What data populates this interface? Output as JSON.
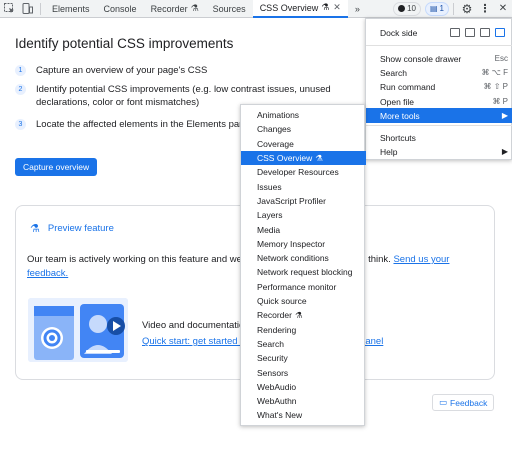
{
  "tabbar": {
    "tabs": [
      {
        "label": "Elements"
      },
      {
        "label": "Console"
      },
      {
        "label": "Recorder"
      },
      {
        "label": "Sources"
      },
      {
        "label": "CSS Overview"
      }
    ],
    "more": "»",
    "error_count": "10",
    "message_count": "1"
  },
  "overview": {
    "heading": "Identify potential CSS improvements",
    "steps": [
      {
        "num": "1",
        "text": "Capture an overview of your page's CSS"
      },
      {
        "num": "2",
        "text": "Identify potential CSS improvements (e.g. low contrast issues, unused declarations, color or font mismatches)"
      },
      {
        "num": "3",
        "text": "Locate the affected elements in the Elements panel"
      }
    ],
    "capture_button": "Capture overview"
  },
  "preview": {
    "title": "Preview feature",
    "text": "Our team is actively working on this feature and we would love to know what you think.",
    "send_link": "Send us your feedback.",
    "video_text": "Video and documentation",
    "quick_start_link": "Quick start: get started with the new CSS Overview panel",
    "overview_panel_link": "view panel"
  },
  "feedback_button": "Feedback",
  "main_menu": {
    "dock_side": "Dock side",
    "items": [
      {
        "label": "Show console drawer",
        "shortcut": "Esc"
      },
      {
        "label": "Search",
        "shortcut": "⌘ ⌥ F"
      },
      {
        "label": "Run command",
        "shortcut": "⌘ ⇧ P"
      },
      {
        "label": "Open file",
        "shortcut": "⌘ P"
      },
      {
        "label": "More tools",
        "shortcut": ""
      },
      {
        "label": "Shortcuts",
        "shortcut": ""
      },
      {
        "label": "Help",
        "shortcut": ""
      }
    ]
  },
  "more_tools": {
    "items": [
      "Animations",
      "Changes",
      "Coverage",
      "CSS Overview",
      "Developer Resources",
      "Issues",
      "JavaScript Profiler",
      "Layers",
      "Media",
      "Memory Inspector",
      "Network conditions",
      "Network request blocking",
      "Performance monitor",
      "Quick source",
      "Recorder",
      "Rendering",
      "Search",
      "Security",
      "Sensors",
      "WebAudio",
      "WebAuthn",
      "What's New"
    ],
    "highlighted": "CSS Overview"
  },
  "colors": {
    "accent": "#1a73e8",
    "text": "#202124"
  }
}
